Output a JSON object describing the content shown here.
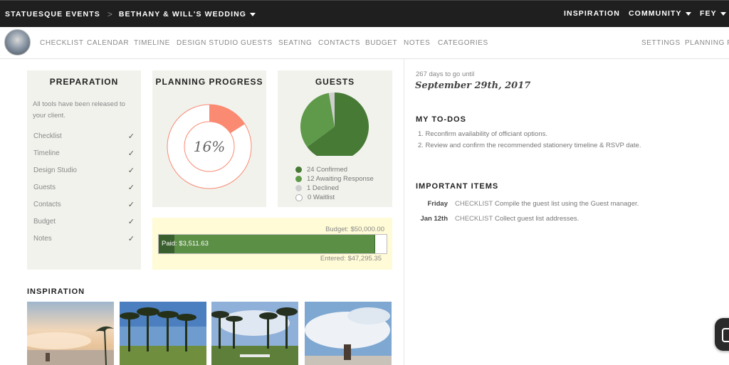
{
  "topbar": {
    "brand": "STATUESQUE EVENTS",
    "separator": ">",
    "event": "BETHANY & WILL'S WEDDING",
    "nav": [
      {
        "label": "INSPIRATION"
      },
      {
        "label": "COMMUNITY"
      },
      {
        "label": "FEY"
      }
    ]
  },
  "subnav": {
    "items": [
      "CHECKLIST",
      "CALENDAR",
      "TIMELINE",
      "DESIGN STUDIO",
      "GUESTS",
      "SEATING",
      "CONTACTS",
      "BUDGET",
      "NOTES",
      "CATEGORIES"
    ],
    "right": [
      "SETTINGS",
      "PLANNING PA"
    ]
  },
  "preparation": {
    "title": "PREPARATION",
    "description": "All tools have been released to your client.",
    "items": [
      "Checklist",
      "Timeline",
      "Design Studio",
      "Guests",
      "Contacts",
      "Budget",
      "Notes"
    ],
    "check_glyph": "✓"
  },
  "progress": {
    "title": "PLANNING PROGRESS",
    "percent_text": "16%",
    "percent_value": 0.16,
    "color": "#fa8a72"
  },
  "guests": {
    "title": "GUESTS",
    "legend": [
      {
        "label": "24 Confirmed",
        "value": 24,
        "color": "#467a35"
      },
      {
        "label": "12 Awaiting Response",
        "value": 12,
        "color": "#5e9a4a"
      },
      {
        "label": "1 Declined",
        "value": 1,
        "color": "#cfcfcf"
      },
      {
        "label": "0 Waitlist",
        "value": 0,
        "color": "#ffffff"
      }
    ]
  },
  "budget": {
    "budget_label": "Budget: $50,000.00",
    "paid_label": "Paid: $3,511.63",
    "entered_label": "Entered: $47,295.35",
    "budget_value": 50000,
    "paid_value": 3511.63,
    "entered_value": 47295.35
  },
  "inspiration": {
    "title": "INSPIRATION",
    "photos": [
      "beach-sunset-photo",
      "palm-trees-photo",
      "palm-trees-aisle-photo",
      "couple-clouds-photo"
    ]
  },
  "countdown": {
    "days_text": "267 days to go until",
    "date_text": "September 29th, 2017"
  },
  "todos": {
    "title": "MY TO-DOS",
    "items": [
      "1. Reconfirm availability of officiant options.",
      "2. Review and confirm the recommended stationery timeline & RSVP date."
    ]
  },
  "important": {
    "title": "IMPORTANT ITEMS",
    "items": [
      {
        "day": "Friday",
        "type": "CHECKLIST",
        "text": "Compile the guest list using the Guest manager."
      },
      {
        "day": "Jan 12th",
        "type": "CHECKLIST",
        "text": "Collect guest list addresses."
      }
    ]
  },
  "colors": {
    "accent_green": "#467a35",
    "progress_salmon": "#fa8a72",
    "budget_bg": "#fffbd6",
    "card_bg": "#f2f2ed"
  }
}
